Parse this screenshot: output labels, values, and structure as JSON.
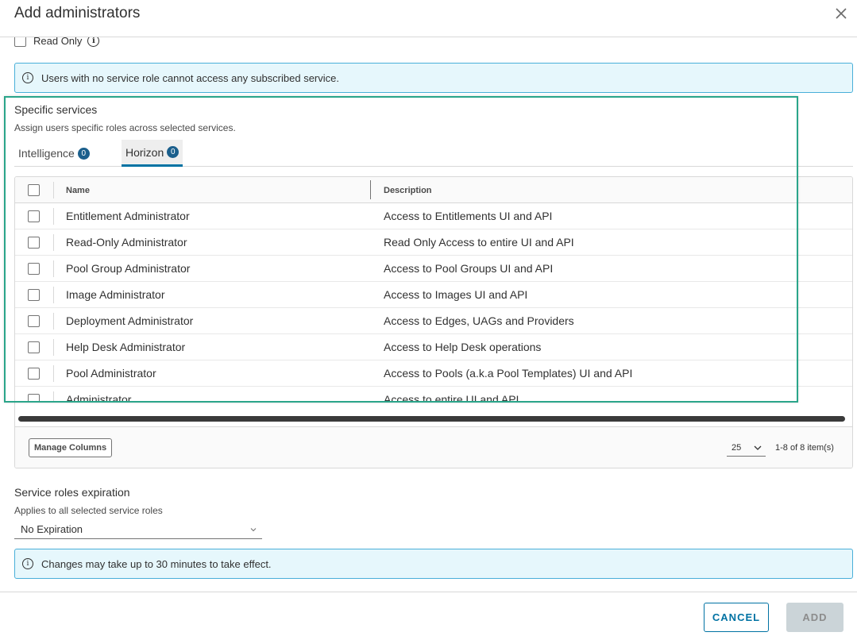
{
  "dialog": {
    "title": "Add administrators"
  },
  "read_only": {
    "label": "Read Only",
    "checked": false
  },
  "alerts": {
    "no_role": "Users with no service role cannot access any subscribed service.",
    "changes": "Changes may take up to 30 minutes to take effect."
  },
  "specific_services": {
    "title": "Specific services",
    "subtitle": "Assign users specific roles across selected services.",
    "tabs": [
      {
        "label": "Intelligence",
        "count": "0",
        "active": false
      },
      {
        "label": "Horizon",
        "count": "0",
        "active": true
      }
    ]
  },
  "grid": {
    "columns": {
      "name": "Name",
      "description": "Description"
    },
    "rows": [
      {
        "name": "Entitlement Administrator",
        "description": "Access to Entitlements UI and API"
      },
      {
        "name": "Read-Only Administrator",
        "description": "Read Only Access to entire UI and API"
      },
      {
        "name": "Pool Group Administrator",
        "description": "Access to Pool Groups UI and API"
      },
      {
        "name": "Image Administrator",
        "description": "Access to Images UI and API"
      },
      {
        "name": "Deployment Administrator",
        "description": "Access to Edges, UAGs and Providers"
      },
      {
        "name": "Help Desk Administrator",
        "description": "Access to Help Desk operations"
      },
      {
        "name": "Pool Administrator",
        "description": "Access to Pools (a.k.a Pool Templates) UI and API"
      },
      {
        "name": "Administrator",
        "description": "Access to entire UI and API"
      }
    ],
    "footer": {
      "manage_columns": "Manage Columns",
      "page_size": "25",
      "item_range": "1-8 of 8 item(s)"
    }
  },
  "expiration": {
    "title": "Service roles expiration",
    "subtitle": "Applies to all selected service roles",
    "value": "No Expiration"
  },
  "buttons": {
    "cancel": "CANCEL",
    "add": "ADD"
  },
  "colors": {
    "accent": "#0072a3",
    "focus": "#2aa58a",
    "alert_bg": "#e6f7fc",
    "badge": "#1b5f8c"
  }
}
